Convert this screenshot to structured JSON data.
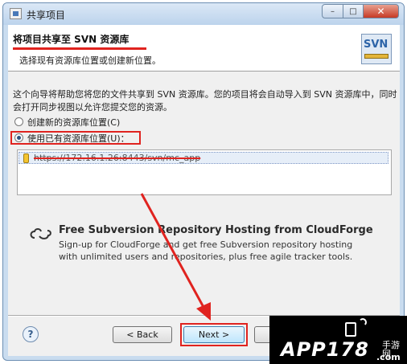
{
  "window": {
    "title": "共享项目",
    "close_glyph": "✕",
    "max_glyph": "□",
    "min_glyph": "–"
  },
  "banner": {
    "title": "将项目共享至 SVN 资源库",
    "description": "选择现有资源库位置或创建新位置。",
    "logo_text": "SVN"
  },
  "intro_text": "这个向导将帮助您将您的文件共享到 SVN 资源库。您的项目将会自动导入到 SVN 资源库中，同时会打开同步视图以允许您提交您的资源。",
  "options": {
    "create_new": "创建新的资源库位置(C)",
    "use_existing": "使用已有资源库位置(U)："
  },
  "repositories": [
    {
      "url": "https://172.16.1.26:8443/svn/mc_app"
    }
  ],
  "cloudforge": {
    "title": "Free Subversion Repository Hosting from CloudForge",
    "line1": "Sign-up for CloudForge and get free Subversion repository hosting",
    "line2": "with unlimited users and repositories, plus free agile tracker tools."
  },
  "buttons": {
    "help": "?",
    "back": "< Back",
    "next": "Next >",
    "finish": ""
  },
  "watermark": {
    "text": "APP178",
    "cn": "手游网",
    "com": ".com"
  },
  "colors": {
    "annotation": "#e0231f",
    "selected_row": "#e6eef8"
  }
}
